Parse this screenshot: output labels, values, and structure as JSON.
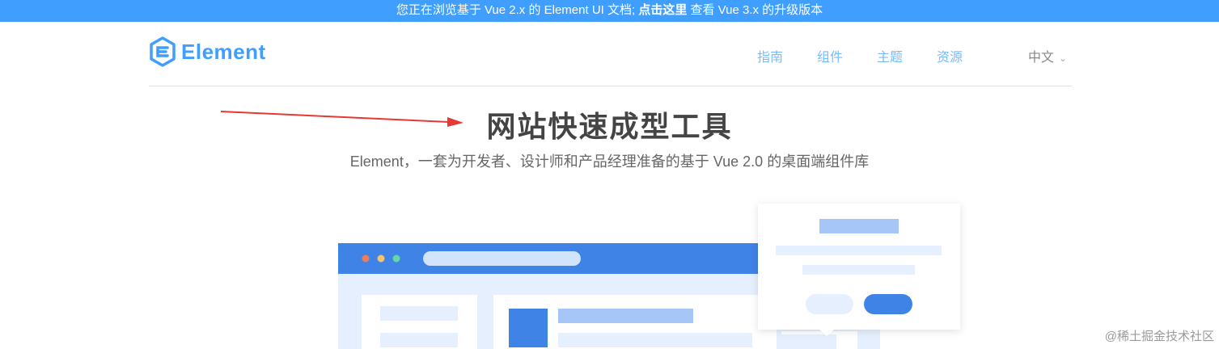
{
  "banner": {
    "text_before": "您正在浏览基于 Vue 2.x 的 Element UI 文档; ",
    "link_label": "点击这里",
    "text_after": " 查看 Vue 3.x 的升级版本"
  },
  "header": {
    "logo_text": "Element",
    "nav": [
      {
        "label": "指南"
      },
      {
        "label": "组件"
      },
      {
        "label": "主题"
      },
      {
        "label": "资源"
      }
    ],
    "language": "中文",
    "language_icon": "chevron-down-icon"
  },
  "hero": {
    "title": "网站快速成型工具",
    "subtitle": "Element，一套为开发者、设计师和产品经理准备的基于 Vue 2.0 的桌面端组件库"
  },
  "watermark": "@稀土掘金技术社区",
  "colors": {
    "brand": "#409eff",
    "annotation_arrow": "#e53935",
    "illustration_header": "#3f83e6",
    "illustration_bg": "#e6effd"
  }
}
